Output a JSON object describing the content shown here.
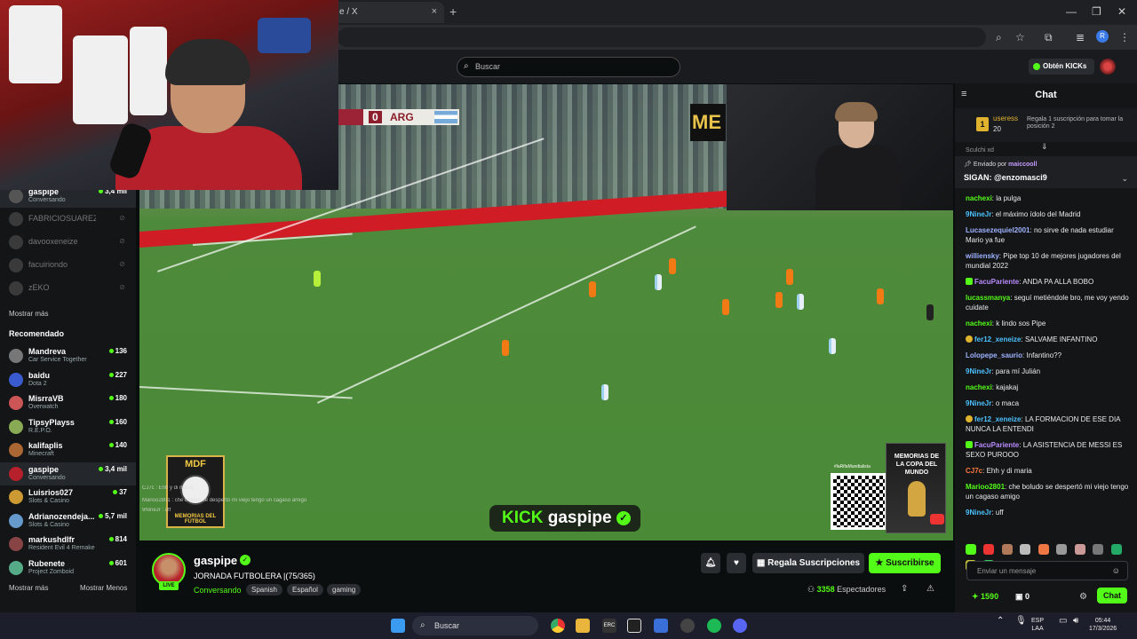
{
  "browser": {
    "tab_title": "e / X",
    "new_tab": "+",
    "close_tab": "×",
    "min": "—",
    "max": "❐",
    "close": "✕",
    "profile_initial": "R"
  },
  "header": {
    "search_placeholder": "Buscar",
    "obtain_label": "Obtén KICKs"
  },
  "sidebar": {
    "following": [
      {
        "name": "gaspipe",
        "category": "Conversando",
        "viewers": "3,4 mil",
        "live": true
      },
      {
        "name": "FABRICIOSUAREZPDC",
        "live": false
      },
      {
        "name": "davooxeneize",
        "live": false
      },
      {
        "name": "facuiriondo",
        "live": false
      },
      {
        "name": "zEKO",
        "live": false
      }
    ],
    "show_more": "Mostrar más",
    "recommended_title": "Recomendado",
    "recommended": [
      {
        "name": "Mandreva",
        "category": "Car Service Together",
        "viewers": "136"
      },
      {
        "name": "baidu",
        "category": "Dota 2",
        "viewers": "227"
      },
      {
        "name": "MisrraVB",
        "category": "Overwatch",
        "viewers": "180"
      },
      {
        "name": "TipsyPlayss",
        "category": "R.E.P.O.",
        "viewers": "160"
      },
      {
        "name": "kalifaplis",
        "category": "Minecraft",
        "viewers": "140"
      },
      {
        "name": "gaspipe",
        "category": "Conversando",
        "viewers": "3,4 mil"
      },
      {
        "name": "Luisrios027",
        "category": "Slots & Casino",
        "viewers": "37"
      },
      {
        "name": "Adrianozendeja...",
        "category": "Slots & Casino",
        "viewers": "5,7 mil"
      },
      {
        "name": "markushdlfr",
        "category": "Resident Evil 4 Remake",
        "viewers": "814"
      },
      {
        "name": "Rubenete",
        "category": "Project Zomboid",
        "viewers": "601"
      }
    ],
    "show_more_bottom": "Mostrar más",
    "show_less": "Mostrar Menos"
  },
  "video": {
    "score": "0",
    "team": "ARG",
    "mem_tag": "ME",
    "mdf_top": "MDF",
    "mdf_bottom": "MEMORIAS DEL FÚTBOL",
    "overlay_chat": [
      "CJ7c : Ehh y di maria",
      "Marioo2801 : che boludo se despertó mi viejo tengo un cagaso amigo",
      "9NineJr : uff"
    ],
    "kick_word": "KICK",
    "banner_name": "gaspipe",
    "qr_caption": "#laRifaMundialista",
    "book_title": "MEMORIAS DE LA COPA DEL MUNDO"
  },
  "stream": {
    "channel": "gaspipe",
    "live": "LIVE",
    "title": "JORNADA FUTBOLERA |(75/365)",
    "category": "Conversando",
    "tags": [
      "Spanish",
      "Español",
      "gaming"
    ],
    "gift_subs_label": "Regala Suscripciones",
    "subscribe_label": "Suscribirse",
    "viewers_count": "3358",
    "viewers_label": "Espectadores"
  },
  "chat": {
    "title": "Chat",
    "gift_user": "useress",
    "gift_count": "20",
    "gift_rank": "1",
    "gift_text": "Regala 1 suscripción para tomar la posición 2",
    "pinned_by_label": "Enviado por",
    "pinned_by_user": "maiccooll",
    "pinned_msg": "SIGAN: @enzomasci9",
    "cut_line": "Sculchi xd",
    "messages": [
      {
        "user": "nachexi",
        "color": "#53fc18",
        "text": "la pulga",
        "badge": ""
      },
      {
        "user": "9NineJr",
        "color": "#4cc2ff",
        "text": "el máximo ídolo del Madrid",
        "badge": ""
      },
      {
        "user": "Lucasezequiel2001",
        "color": "#9fb3ff",
        "text": "no sirve de nada estudiar Mario ya fue",
        "badge": ""
      },
      {
        "user": "williensky",
        "color": "#9fb3ff",
        "text": "Pipe top 10 de mejores jugadores del mundial 2022",
        "badge": ""
      },
      {
        "user": "FacuPariente",
        "color": "#b98cff",
        "text": "ANDA PA ALLA BOBO",
        "badge": "g"
      },
      {
        "user": "lucassmanya",
        "color": "#53fc18",
        "text": "seguí metiéndole bro, me voy yendo cuidate",
        "badge": ""
      },
      {
        "user": "nachexi",
        "color": "#53fc18",
        "text": "k lindo sos Pipe",
        "badge": ""
      },
      {
        "user": "fer12_xeneize",
        "color": "#4cc2ff",
        "text": "SALVAME INFANTINO",
        "badge": "y"
      },
      {
        "user": "Lolopepe_saurio",
        "color": "#9fb3ff",
        "text": "Infantino??",
        "badge": ""
      },
      {
        "user": "9NineJr",
        "color": "#4cc2ff",
        "text": "para mí Julián",
        "badge": ""
      },
      {
        "user": "nachexi",
        "color": "#53fc18",
        "text": "kajakaj",
        "badge": ""
      },
      {
        "user": "9NineJr",
        "color": "#4cc2ff",
        "text": "o maca",
        "badge": ""
      },
      {
        "user": "fer12_xeneize",
        "color": "#4cc2ff",
        "text": "LA FORMACION DE ESE DIA NUNCA LA ENTENDI",
        "badge": "y"
      },
      {
        "user": "FacuPariente",
        "color": "#b98cff",
        "text": "LA ASISTENCIA DE MESSI ES SEXO PUROOO",
        "badge": "g"
      },
      {
        "user": "CJ7c",
        "color": "#ff7a3d",
        "text": "Ehh y di maria",
        "badge": ""
      },
      {
        "user": "Marioo2801",
        "color": "#53fc18",
        "text": "che boludo se despertó mi viejo tengo un cagaso amigo",
        "badge": ""
      },
      {
        "user": "9NineJr",
        "color": "#4cc2ff",
        "text": "uff",
        "badge": ""
      }
    ],
    "input_placeholder": "Enviar un mensaje",
    "points": "1590",
    "points2": "0",
    "send_label": "Chat"
  },
  "taskbar": {
    "search": "Buscar",
    "lang": "ESP",
    "region": "LAA",
    "time": "05:44",
    "date": "17/3/2026",
    "kbd_icon": "ERC"
  },
  "colors": {
    "accent": "#53fc18",
    "background": "#0b0e0f",
    "panel": "#141517"
  }
}
